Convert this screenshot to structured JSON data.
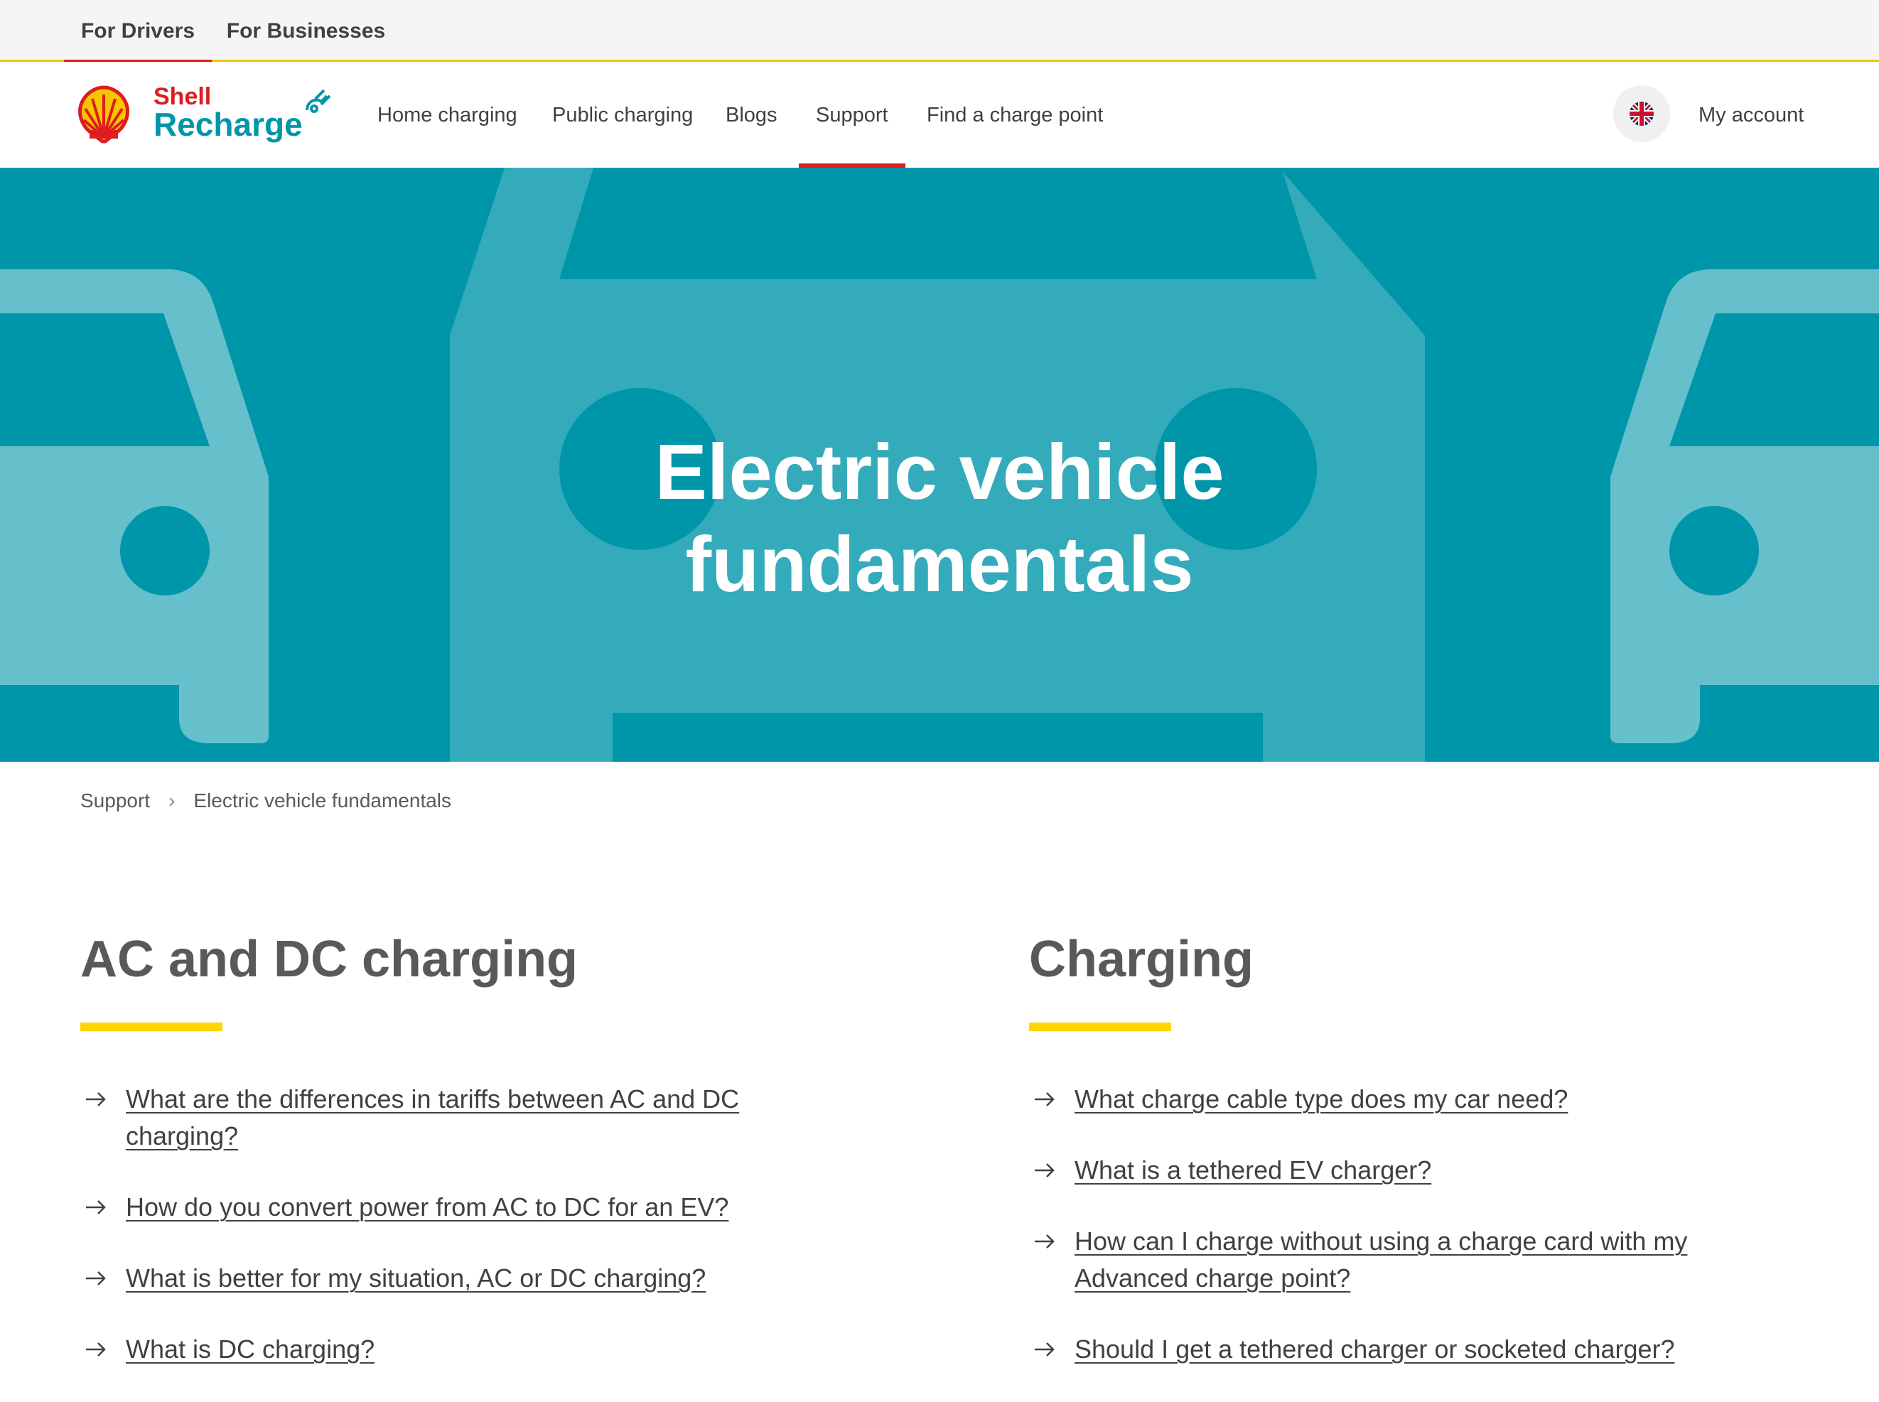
{
  "segments": {
    "drivers": "For Drivers",
    "businesses": "For Businesses"
  },
  "brand": {
    "shell": "Shell",
    "recharge": "Recharge",
    "red": "#dd1d21",
    "teal": "#0096aa",
    "yellow": "#ffd500"
  },
  "nav": {
    "items": [
      {
        "label": "Home charging"
      },
      {
        "label": "Public charging"
      },
      {
        "label": "Blogs"
      },
      {
        "label": "Support",
        "active": true
      },
      {
        "label": "Find a charge point"
      }
    ],
    "language_icon": "uk-flag-icon",
    "account": "My account"
  },
  "hero": {
    "title_line1": "Electric vehicle",
    "title_line2": "fundamentals"
  },
  "breadcrumb": {
    "items": [
      "Support",
      "Electric vehicle fundamentals"
    ],
    "separator": "›"
  },
  "sections": [
    {
      "title": "AC and DC charging",
      "questions": [
        "What are the differences in tariffs between AC and DC charging?",
        "How do you convert power from AC to DC for an EV?",
        "What is better for my situation, AC or DC charging?",
        "What is DC charging?"
      ]
    },
    {
      "title": "Charging",
      "questions": [
        "What charge cable type does my car need?",
        "What is a tethered EV charger?",
        "How can I charge without using a charge card with my Advanced charge point?",
        "Should I get a tethered charger or socketed charger?"
      ]
    }
  ]
}
